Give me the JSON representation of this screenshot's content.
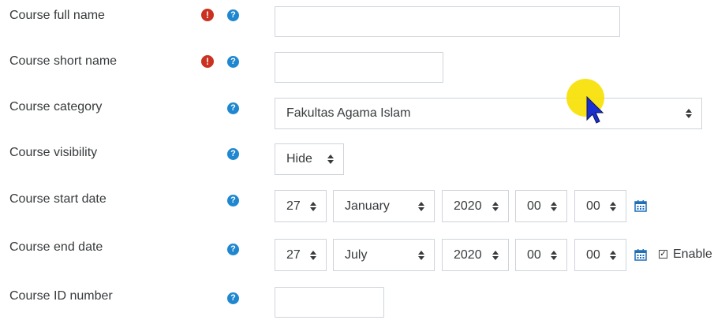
{
  "fields": {
    "full_name": {
      "label": "Course full name",
      "value": ""
    },
    "short_name": {
      "label": "Course short name",
      "value": ""
    },
    "category": {
      "label": "Course category",
      "value": "Fakultas Agama Islam"
    },
    "visibility": {
      "label": "Course visibility",
      "value": "Hide"
    },
    "start_date": {
      "label": "Course start date",
      "day": "27",
      "month": "January",
      "year": "2020",
      "hour": "00",
      "minute": "00"
    },
    "end_date": {
      "label": "Course end date",
      "day": "27",
      "month": "July",
      "year": "2020",
      "hour": "00",
      "minute": "00",
      "enable_label": "Enable",
      "enabled": true
    },
    "id_number": {
      "label": "Course ID number",
      "value": ""
    }
  },
  "icons": {
    "required": "exclamation-circle-icon",
    "help": "question-circle-icon",
    "calendar": "calendar-icon",
    "caret": "sort-caret-icon"
  },
  "colors": {
    "required": "#ca3120",
    "help": "#1f87d0",
    "border": "#ced4da",
    "text": "#373a3c",
    "cursor_highlight": "#f7e000",
    "cursor": "#1a2fd0"
  }
}
